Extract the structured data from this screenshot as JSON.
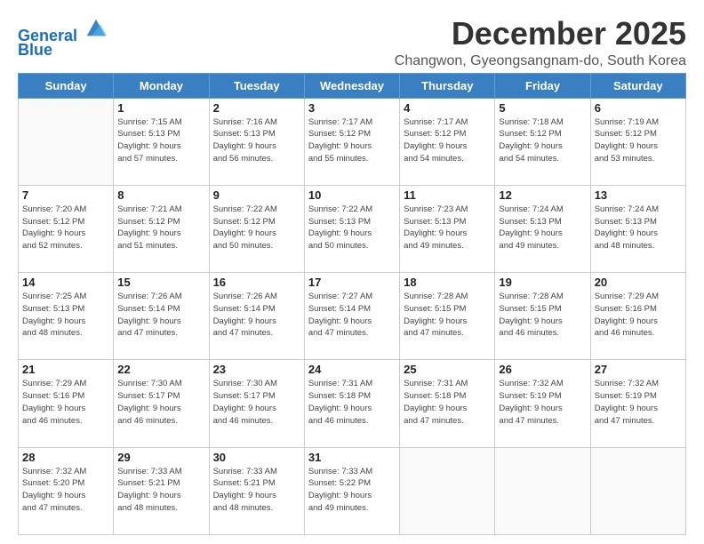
{
  "header": {
    "logo_line1": "General",
    "logo_line2": "Blue",
    "month": "December 2025",
    "location": "Changwon, Gyeongsangnam-do, South Korea"
  },
  "weekdays": [
    "Sunday",
    "Monday",
    "Tuesday",
    "Wednesday",
    "Thursday",
    "Friday",
    "Saturday"
  ],
  "weeks": [
    [
      {
        "day": "",
        "info": ""
      },
      {
        "day": "1",
        "info": "Sunrise: 7:15 AM\nSunset: 5:13 PM\nDaylight: 9 hours\nand 57 minutes."
      },
      {
        "day": "2",
        "info": "Sunrise: 7:16 AM\nSunset: 5:13 PM\nDaylight: 9 hours\nand 56 minutes."
      },
      {
        "day": "3",
        "info": "Sunrise: 7:17 AM\nSunset: 5:12 PM\nDaylight: 9 hours\nand 55 minutes."
      },
      {
        "day": "4",
        "info": "Sunrise: 7:17 AM\nSunset: 5:12 PM\nDaylight: 9 hours\nand 54 minutes."
      },
      {
        "day": "5",
        "info": "Sunrise: 7:18 AM\nSunset: 5:12 PM\nDaylight: 9 hours\nand 54 minutes."
      },
      {
        "day": "6",
        "info": "Sunrise: 7:19 AM\nSunset: 5:12 PM\nDaylight: 9 hours\nand 53 minutes."
      }
    ],
    [
      {
        "day": "7",
        "info": "Sunrise: 7:20 AM\nSunset: 5:12 PM\nDaylight: 9 hours\nand 52 minutes."
      },
      {
        "day": "8",
        "info": "Sunrise: 7:21 AM\nSunset: 5:12 PM\nDaylight: 9 hours\nand 51 minutes."
      },
      {
        "day": "9",
        "info": "Sunrise: 7:22 AM\nSunset: 5:12 PM\nDaylight: 9 hours\nand 50 minutes."
      },
      {
        "day": "10",
        "info": "Sunrise: 7:22 AM\nSunset: 5:13 PM\nDaylight: 9 hours\nand 50 minutes."
      },
      {
        "day": "11",
        "info": "Sunrise: 7:23 AM\nSunset: 5:13 PM\nDaylight: 9 hours\nand 49 minutes."
      },
      {
        "day": "12",
        "info": "Sunrise: 7:24 AM\nSunset: 5:13 PM\nDaylight: 9 hours\nand 49 minutes."
      },
      {
        "day": "13",
        "info": "Sunrise: 7:24 AM\nSunset: 5:13 PM\nDaylight: 9 hours\nand 48 minutes."
      }
    ],
    [
      {
        "day": "14",
        "info": "Sunrise: 7:25 AM\nSunset: 5:13 PM\nDaylight: 9 hours\nand 48 minutes."
      },
      {
        "day": "15",
        "info": "Sunrise: 7:26 AM\nSunset: 5:14 PM\nDaylight: 9 hours\nand 47 minutes."
      },
      {
        "day": "16",
        "info": "Sunrise: 7:26 AM\nSunset: 5:14 PM\nDaylight: 9 hours\nand 47 minutes."
      },
      {
        "day": "17",
        "info": "Sunrise: 7:27 AM\nSunset: 5:14 PM\nDaylight: 9 hours\nand 47 minutes."
      },
      {
        "day": "18",
        "info": "Sunrise: 7:28 AM\nSunset: 5:15 PM\nDaylight: 9 hours\nand 47 minutes."
      },
      {
        "day": "19",
        "info": "Sunrise: 7:28 AM\nSunset: 5:15 PM\nDaylight: 9 hours\nand 46 minutes."
      },
      {
        "day": "20",
        "info": "Sunrise: 7:29 AM\nSunset: 5:16 PM\nDaylight: 9 hours\nand 46 minutes."
      }
    ],
    [
      {
        "day": "21",
        "info": "Sunrise: 7:29 AM\nSunset: 5:16 PM\nDaylight: 9 hours\nand 46 minutes."
      },
      {
        "day": "22",
        "info": "Sunrise: 7:30 AM\nSunset: 5:17 PM\nDaylight: 9 hours\nand 46 minutes."
      },
      {
        "day": "23",
        "info": "Sunrise: 7:30 AM\nSunset: 5:17 PM\nDaylight: 9 hours\nand 46 minutes."
      },
      {
        "day": "24",
        "info": "Sunrise: 7:31 AM\nSunset: 5:18 PM\nDaylight: 9 hours\nand 46 minutes."
      },
      {
        "day": "25",
        "info": "Sunrise: 7:31 AM\nSunset: 5:18 PM\nDaylight: 9 hours\nand 47 minutes."
      },
      {
        "day": "26",
        "info": "Sunrise: 7:32 AM\nSunset: 5:19 PM\nDaylight: 9 hours\nand 47 minutes."
      },
      {
        "day": "27",
        "info": "Sunrise: 7:32 AM\nSunset: 5:19 PM\nDaylight: 9 hours\nand 47 minutes."
      }
    ],
    [
      {
        "day": "28",
        "info": "Sunrise: 7:32 AM\nSunset: 5:20 PM\nDaylight: 9 hours\nand 47 minutes."
      },
      {
        "day": "29",
        "info": "Sunrise: 7:33 AM\nSunset: 5:21 PM\nDaylight: 9 hours\nand 48 minutes."
      },
      {
        "day": "30",
        "info": "Sunrise: 7:33 AM\nSunset: 5:21 PM\nDaylight: 9 hours\nand 48 minutes."
      },
      {
        "day": "31",
        "info": "Sunrise: 7:33 AM\nSunset: 5:22 PM\nDaylight: 9 hours\nand 49 minutes."
      },
      {
        "day": "",
        "info": ""
      },
      {
        "day": "",
        "info": ""
      },
      {
        "day": "",
        "info": ""
      }
    ]
  ]
}
